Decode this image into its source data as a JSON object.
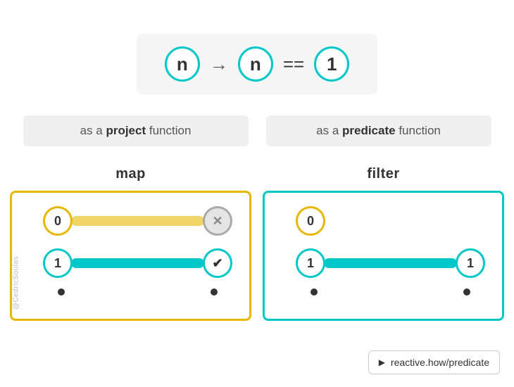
{
  "formula": {
    "n_label": "n",
    "arrow": "→",
    "equals_label": "==",
    "one_label": "1"
  },
  "labels": {
    "project": {
      "prefix": "as a ",
      "bold": "project",
      "suffix": " function"
    },
    "predicate": {
      "prefix": "as a ",
      "bold": "predicate",
      "suffix": " function"
    }
  },
  "map_diagram": {
    "title": "map",
    "row0": {
      "input": "0",
      "output_symbol": "✕",
      "track_type": "yellow"
    },
    "row1": {
      "input": "1",
      "output_symbol": "✔",
      "track_type": "teal"
    }
  },
  "filter_diagram": {
    "title": "filter",
    "row0": {
      "input": "0",
      "has_output": false
    },
    "row1": {
      "input": "1",
      "output_value": "1",
      "track_type": "teal"
    }
  },
  "watermark": "@CedricSoulas",
  "link": {
    "play_icon": "▶",
    "text": "reactive.how/predicate"
  }
}
